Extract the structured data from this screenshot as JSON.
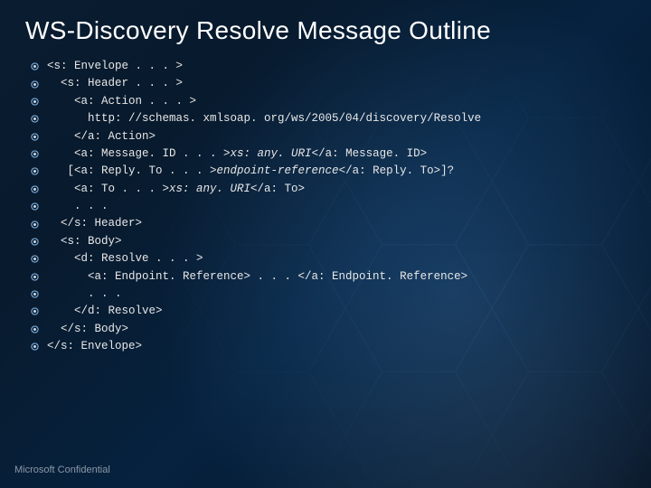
{
  "title": "WS-Discovery Resolve Message Outline",
  "footer": "Microsoft Confidential",
  "lines": {
    "l0": "<s: Envelope . . . >",
    "l1": "  <s: Header . . . >",
    "l2": "    <a: Action . . . >",
    "l3": "      http: //schemas. xmlsoap. org/ws/2005/04/discovery/Resolve",
    "l4": "    </a: Action>",
    "l5a": "    <a: Message. ID . . . >",
    "l5b": "xs: any. URI",
    "l5c": "</a: Message. ID>",
    "l6a": "   [<a: Reply. To . . . >",
    "l6b": "endpoint-reference",
    "l6c": "</a: Reply. To>]?",
    "l7a": "    <a: To . . . >",
    "l7b": "xs: any. URI",
    "l7c": "</a: To>",
    "l8": "    . . .",
    "l9": "  </s: Header>",
    "l10": "  <s: Body>",
    "l11": "    <d: Resolve . . . >",
    "l12": "      <a: Endpoint. Reference> . . . </a: Endpoint. Reference>",
    "l13": "      . . .",
    "l14": "    </d: Resolve>",
    "l15": "  </s: Body>",
    "l16": "</s: Envelope>"
  }
}
